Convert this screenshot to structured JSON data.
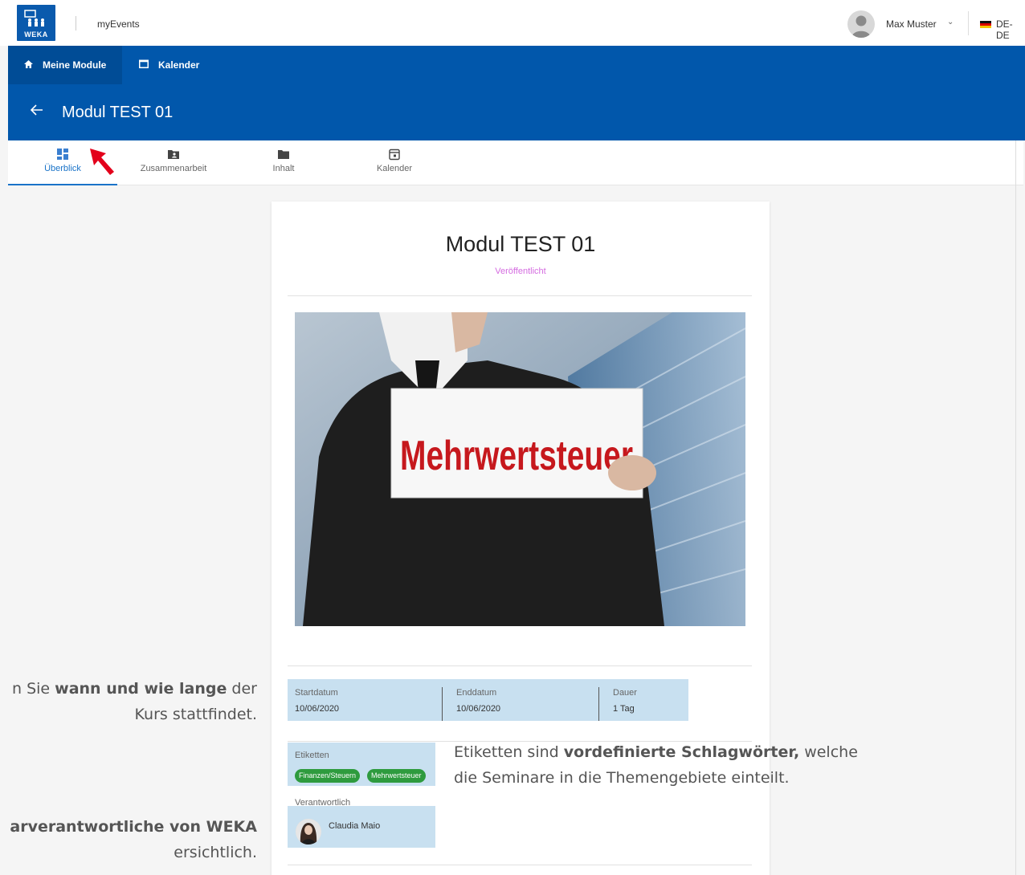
{
  "app": {
    "logo_text": "WEKA",
    "name": "myEvents"
  },
  "user": {
    "name": "Max Muster",
    "avatar_icon": "user-avatar-icon",
    "caret_icon": "chevron-down-icon"
  },
  "lang": {
    "flag_icon": "germany-flag-icon",
    "label": "DE-DE"
  },
  "nav": {
    "items": [
      {
        "label": "Meine Module",
        "icon": "home-icon"
      },
      {
        "label": "Kalender",
        "icon": "calendar-icon"
      }
    ]
  },
  "header": {
    "back_icon": "arrow-back-icon",
    "title": "Modul TEST 01"
  },
  "tabs": [
    {
      "label": "Überblick",
      "icon": "dashboard-icon",
      "active": true
    },
    {
      "label": "Zusammenarbeit",
      "icon": "folder-shared-icon"
    },
    {
      "label": "Inhalt",
      "icon": "folder-icon"
    },
    {
      "label": "Kalender",
      "icon": "calendar-icon"
    }
  ],
  "card": {
    "title": "Modul TEST 01",
    "status": "Veröffentlicht",
    "hero_sign": "Mehrwertsteuer",
    "info": [
      {
        "label": "Startdatum",
        "value": "10/06/2020"
      },
      {
        "label": "Enddatum",
        "value": "10/06/2020"
      },
      {
        "label": "Dauer",
        "value": "1 Tag"
      }
    ],
    "tags_label": "Etiketten",
    "tags": [
      "Finanzen/Steuern",
      "Mehrwertsteuer"
    ],
    "responsible_label": "Verantwortlich",
    "responsible_name": "Claudia Maio"
  },
  "annotations": {
    "when": {
      "line1_pre": "n Sie ",
      "line1_bold": "wann und wie lange",
      "line1_post": " der",
      "line2": "Kurs stattfindet."
    },
    "tags": {
      "line1_pre": "Etiketten sind ",
      "line1_bold": "vordefinierte Schlagwörter,",
      "line1_post": " welche",
      "line2": "die Seminare in die Themengebiete einteilt."
    },
    "responsible": {
      "line1_bold": "arverantwortliche von WEKA",
      "line2": "ersichtlich."
    }
  },
  "colors": {
    "brand_blue": "#0157ab",
    "tab_active": "#1a73c8",
    "status_purple": "#d46be0",
    "tag_green": "#2e9b3e",
    "highlight_blue": "#c8e0f0",
    "pointer_red": "#e3001b"
  }
}
